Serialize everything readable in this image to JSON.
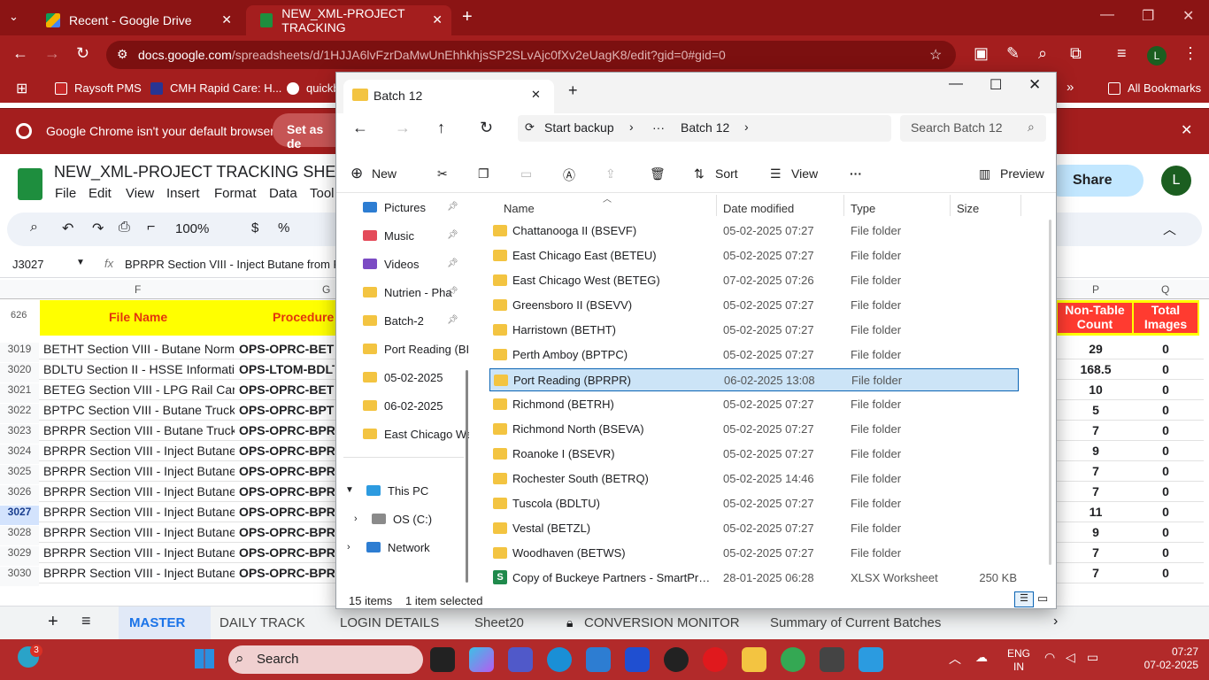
{
  "chrome": {
    "tabs": [
      {
        "title": "Recent - Google Drive"
      },
      {
        "title": "NEW_XML-PROJECT TRACKING"
      }
    ],
    "url_host": "docs.google.com",
    "url_path": "/spreadsheets/d/1HJJA6lvFzrDaMwUnEhhkhjsSP2SLvAjc0fXv2eUagK8/edit?gid=0#gid=0",
    "profile_initial": "L",
    "bookmarks": [
      "Raysoft PMS",
      "CMH Rapid Care: H...",
      "quickb"
    ],
    "all_bookmarks": "All Bookmarks",
    "infobar_text": "Google Chrome isn't your default browser",
    "infobar_button": "Set as de"
  },
  "sheets": {
    "doc_title": "NEW_XML-PROJECT TRACKING SHEET",
    "menus": [
      "File",
      "Edit",
      "View",
      "Insert",
      "Format",
      "Data",
      "Tool"
    ],
    "zoom": "100%",
    "share": "Share",
    "cell_ref": "J3027",
    "formula": "BPRPR Section VIII - Inject Butane from Rail",
    "col_F": "F",
    "col_G": "G",
    "col_P": "P",
    "col_Q": "Q",
    "frozen_row": "626",
    "header_file_name": "File Name",
    "header_procedure": "Procedure",
    "header_non_table_1": "Non-Table",
    "header_non_table_2": "Count",
    "header_total_1": "Total",
    "header_total_2": "Images",
    "rows": [
      {
        "n": "3019",
        "f": "BETHT Section VIII - Butane Normal S",
        "g": "OPS-OPRC-BETHT-",
        "p": "29",
        "q": "0"
      },
      {
        "n": "3020",
        "f": "BDLTU Section II - HSSE Information",
        "g": "OPS-LTOM-BDLTU",
        "p": "168.5",
        "q": "0"
      },
      {
        "n": "3021",
        "f": "BETEG Section VIII - LPG Rail Car Unl",
        "g": "OPS-OPRC-BETEG-",
        "p": "10",
        "q": "0"
      },
      {
        "n": "3022",
        "f": "BPTPC Section VIII - Butane Truck Un",
        "g": "OPS-OPRC-BPTPC-",
        "p": "5",
        "q": "0"
      },
      {
        "n": "3023",
        "f": "BPRPR Section VIII - Butane Truck Un",
        "g": "OPS-OPRC-BPRPR",
        "p": "7",
        "q": "0"
      },
      {
        "n": "3024",
        "f": "BPRPR Section VIII - Inject Butane fro",
        "g": "OPS-OPRC-BPRPR",
        "p": "9",
        "q": "0"
      },
      {
        "n": "3025",
        "f": "BPRPR Section VIII - Inject Butane fro",
        "g": "OPS-OPRC-BPRPR",
        "p": "7",
        "q": "0"
      },
      {
        "n": "3026",
        "f": "BPRPR Section VIII - Inject Butane fro",
        "g": "OPS-OPRC-BPRPR",
        "p": "7",
        "q": "0"
      },
      {
        "n": "3027",
        "f": "BPRPR Section VIII - Inject Butane fro",
        "g": "OPS-OPRC-BPRPR",
        "p": "11",
        "q": "0"
      },
      {
        "n": "3028",
        "f": "BPRPR Section VIII - Inject Butane fro",
        "g": "OPS-OPRC-BPRPR",
        "p": "9",
        "q": "0"
      },
      {
        "n": "3029",
        "f": "BPRPR Section VIII - Inject Butane fro",
        "g": "OPS-OPRC-BPRPR",
        "p": "7",
        "q": "0"
      },
      {
        "n": "3030",
        "f": "BPRPR Section VIII - Inject Butane fro",
        "g": "OPS-OPRC-BPRPR",
        "p": "7",
        "q": "0"
      }
    ],
    "sheet_tabs": [
      "MASTER",
      "DAILY TRACK",
      "LOGIN DETAILS",
      "Sheet20",
      "CONVERSION MONITOR",
      "Summary of Current Batches"
    ]
  },
  "explorer": {
    "tab_title": "Batch 12",
    "breadcrumb_root": "Start backup",
    "breadcrumb_more": "···",
    "breadcrumb_current": "Batch 12",
    "search_placeholder": "Search Batch 12",
    "cmd_new": "New",
    "cmd_sort": "Sort",
    "cmd_view": "View",
    "cmd_more": "···",
    "cmd_preview": "Preview",
    "nav": [
      "Pictures",
      "Music",
      "Videos",
      "Nutrien - Pha",
      "Batch-2",
      "Port Reading (BI",
      "05-02-2025",
      "06-02-2025",
      "East Chicago We"
    ],
    "this_pc": "This PC",
    "os_drive": "OS (C:)",
    "network": "Network",
    "col_name": "Name",
    "col_date": "Date modified",
    "col_type": "Type",
    "col_size": "Size",
    "files": [
      {
        "name": "Chattanooga II (BSEVF)",
        "date": "05-02-2025 07:27",
        "type": "File folder",
        "size": ""
      },
      {
        "name": "East Chicago East (BETEU)",
        "date": "05-02-2025 07:27",
        "type": "File folder",
        "size": ""
      },
      {
        "name": "East Chicago West (BETEG)",
        "date": "07-02-2025 07:26",
        "type": "File folder",
        "size": ""
      },
      {
        "name": "Greensboro II (BSEVV)",
        "date": "05-02-2025 07:27",
        "type": "File folder",
        "size": ""
      },
      {
        "name": "Harristown (BETHT)",
        "date": "05-02-2025 07:27",
        "type": "File folder",
        "size": ""
      },
      {
        "name": "Perth Amboy (BPTPC)",
        "date": "05-02-2025 07:27",
        "type": "File folder",
        "size": ""
      },
      {
        "name": "Port Reading (BPRPR)",
        "date": "06-02-2025 13:08",
        "type": "File folder",
        "size": ""
      },
      {
        "name": "Richmond (BETRH)",
        "date": "05-02-2025 07:27",
        "type": "File folder",
        "size": ""
      },
      {
        "name": "Richmond North (BSEVA)",
        "date": "05-02-2025 07:27",
        "type": "File folder",
        "size": ""
      },
      {
        "name": "Roanoke I (BSEVR)",
        "date": "05-02-2025 07:27",
        "type": "File folder",
        "size": ""
      },
      {
        "name": "Rochester South (BETRQ)",
        "date": "05-02-2025 14:46",
        "type": "File folder",
        "size": ""
      },
      {
        "name": "Tuscola (BDLTU)",
        "date": "05-02-2025 07:27",
        "type": "File folder",
        "size": ""
      },
      {
        "name": "Vestal (BETZL)",
        "date": "05-02-2025 07:27",
        "type": "File folder",
        "size": ""
      },
      {
        "name": "Woodhaven (BETWS)",
        "date": "05-02-2025 07:27",
        "type": "File folder",
        "size": ""
      },
      {
        "name": "Copy of Buckeye Partners - SmartProced...",
        "date": "28-01-2025 06:28",
        "type": "XLSX Worksheet",
        "size": "250 KB"
      }
    ],
    "selected_index": 6,
    "status_items": "15 items",
    "status_selected": "1 item selected"
  },
  "taskbar": {
    "search": "Search",
    "badge": "3",
    "lang_1": "ENG",
    "lang_2": "IN",
    "time": "07:27",
    "date": "07-02-2025"
  },
  "colors": {
    "chrome_bg": "#a41e1e",
    "selection_fill": "#cce4f7",
    "selection_border": "#0a64b4",
    "sheet_header_yellow": "#ffff00",
    "sheet_header_text": "#e3350d"
  }
}
